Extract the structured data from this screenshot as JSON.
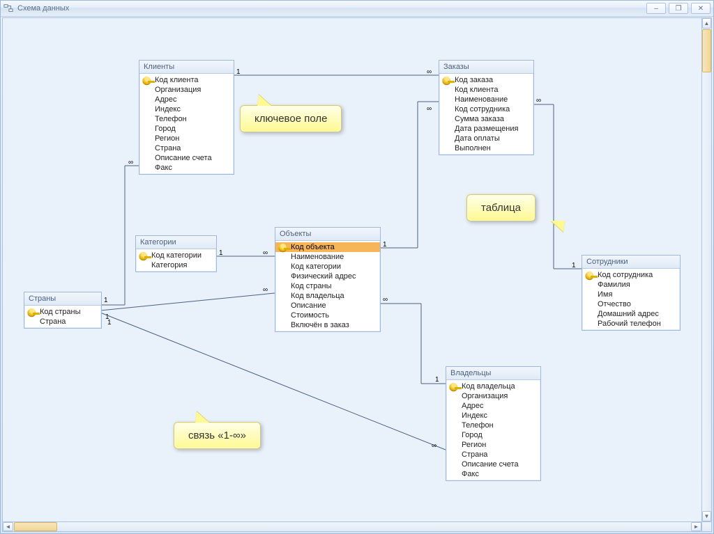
{
  "window": {
    "title": "Схема данных",
    "min": "–",
    "restore": "❐",
    "close": "✕"
  },
  "callouts": {
    "keyField": "ключевое поле",
    "table": "таблица",
    "link": "связь «1-∞»"
  },
  "relationship_labels": {
    "one": "1",
    "many": "∞"
  },
  "tables": {
    "clients": {
      "title": "Клиенты",
      "fields": [
        "Код клиента",
        "Организация",
        "Адрес",
        "Индекс",
        "Телефон",
        "Город",
        "Регион",
        "Страна",
        "Описание счета",
        "Факс"
      ],
      "pkIndex": 0
    },
    "orders": {
      "title": "Заказы",
      "fields": [
        "Код заказа",
        "Код клиента",
        "Наименование",
        "Код сотрудника",
        "Сумма заказа",
        "Дата размещения",
        "Дата оплаты",
        "Выполнен"
      ],
      "pkIndex": 0
    },
    "categories": {
      "title": "Категории",
      "fields": [
        "Код категории",
        "Категория"
      ],
      "pkIndex": 0
    },
    "objects": {
      "title": "Объекты",
      "fields": [
        "Код объекта",
        "Наименование",
        "Код категории",
        "Физический адрес",
        "Код страны",
        "Код владельца",
        "Описание",
        "Стоимость",
        "Включён в заказ"
      ],
      "pkIndex": 0,
      "selectedIndex": 0
    },
    "countries": {
      "title": "Страны",
      "fields": [
        "Код страны",
        "Страна"
      ],
      "pkIndex": 0
    },
    "employees": {
      "title": "Сотрудники",
      "fields": [
        "Код сотрудника",
        "Фамилия",
        "Имя",
        "Отчество",
        "Домашний адрес",
        "Рабочий телефон"
      ],
      "pkIndex": 0
    },
    "owners": {
      "title": "Владельцы",
      "fields": [
        "Код владельца",
        "Организация",
        "Адрес",
        "Индекс",
        "Телефон",
        "Город",
        "Регион",
        "Страна",
        "Описание счета",
        "Факс"
      ],
      "pkIndex": 0
    }
  },
  "relationships": [
    {
      "from": "clients",
      "to": "orders",
      "fromSide": "right",
      "toSide": "left",
      "type": "1-∞"
    },
    {
      "from": "orders",
      "to": "employees",
      "fromSide": "right",
      "toSide": "left",
      "type": "∞-1"
    },
    {
      "from": "categories",
      "to": "objects",
      "fromSide": "right",
      "toSide": "left",
      "type": "1-∞"
    },
    {
      "from": "objects",
      "to": "orders",
      "fromSide": "right",
      "toSide": "left",
      "type": "1-∞"
    },
    {
      "from": "countries",
      "to": "clients",
      "fromSide": "right",
      "toSide": "left",
      "type": "1-∞"
    },
    {
      "from": "countries",
      "to": "objects",
      "fromSide": "right",
      "toSide": "left",
      "type": "1-∞"
    },
    {
      "from": "countries",
      "to": "owners",
      "fromSide": "right",
      "toSide": "left",
      "type": "1-∞"
    },
    {
      "from": "objects",
      "to": "owners",
      "fromSide": "right",
      "toSide": "left",
      "type": "∞-1"
    }
  ]
}
